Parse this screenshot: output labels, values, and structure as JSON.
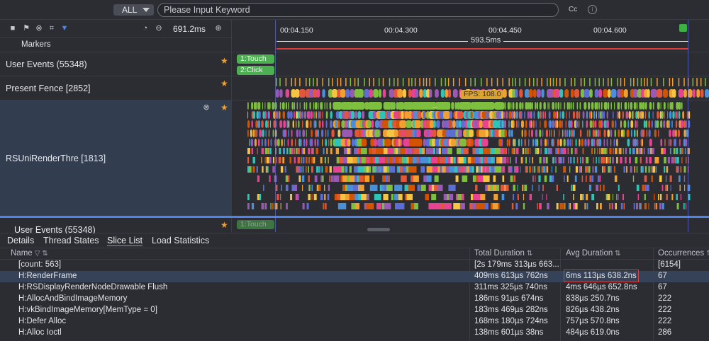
{
  "search": {
    "scope": "ALL",
    "placeholder": "Please Input Keyword",
    "case_toggle": "Cc",
    "info": "i"
  },
  "toolbar": {
    "zoom_value": "691.2ms"
  },
  "markers_label": "Markers",
  "ruler": {
    "ticks": [
      "00:04.150",
      "00:04.300",
      "00:04.450",
      "00:04.600"
    ],
    "range_label": "593.5ms"
  },
  "tracks": [
    {
      "name": "User Events (55348)",
      "events": [
        "1:Touch",
        "2:Click"
      ]
    },
    {
      "name": "Present Fence [2852]",
      "fps_label": "FPS: 108.0"
    },
    {
      "name": "RSUniRenderThre [1813]",
      "ellipsis": "..."
    },
    {
      "name": "User Events (55348)",
      "events": [
        "1:Touch"
      ]
    }
  ],
  "tabs": [
    "Details",
    "Thread States",
    "Slice List",
    "Load Statistics"
  ],
  "active_tab": "Slice List",
  "table": {
    "columns": [
      "Name",
      "Total Duration",
      "Avg Duration",
      "Occurrences"
    ],
    "rows": [
      {
        "name": "[count: 563]",
        "total": "[2s 179ms 313µs 663...",
        "avg": "",
        "occ": "[6154]"
      },
      {
        "name": "H:RenderFrame",
        "total": "409ms 613µs 762ns",
        "avg": "6ms 113µs 638.2ns",
        "occ": "67"
      },
      {
        "name": "H:RSDisplayRenderNodeDrawable Flush",
        "total": "311ms 325µs 740ns",
        "avg": "4ms 646µs 652.8ns",
        "occ": "67"
      },
      {
        "name": "H:AllocAndBindImageMemory",
        "total": "186ms 91µs 674ns",
        "avg": "838µs 250.7ns",
        "occ": "222"
      },
      {
        "name": "H:vkBindImageMemory[MemType = 0]",
        "total": "183ms 469µs 282ns",
        "avg": "826µs 438.2ns",
        "occ": "222"
      },
      {
        "name": "H:Defer Alloc",
        "total": "168ms 180µs 724ns",
        "avg": "757µs 570.8ns",
        "occ": "222"
      },
      {
        "name": "H:Alloc Ioctl",
        "total": "138ms 601µs 38ns",
        "avg": "484µs 619.0ns",
        "occ": "286"
      }
    ]
  },
  "colors": {
    "accent": "#4f83e8",
    "event_green": "#4caf50",
    "highlight_red": "#d04545",
    "star": "#f0a030"
  }
}
